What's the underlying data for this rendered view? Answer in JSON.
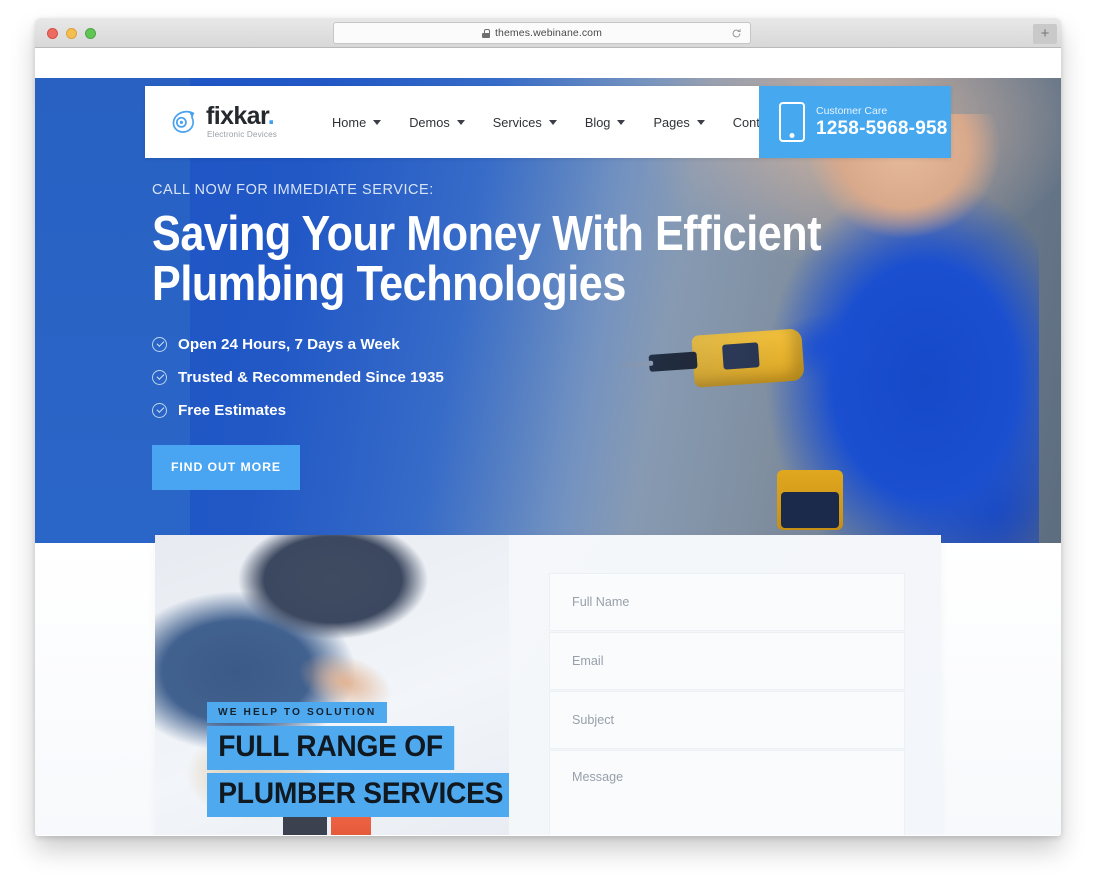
{
  "browser": {
    "url": "themes.webinane.com",
    "lock_icon": "lock-icon",
    "reload_icon": "reload-icon",
    "new_tab_label": "+",
    "traffic_lights": [
      "close",
      "minimize",
      "zoom"
    ]
  },
  "site": {
    "brand": {
      "name": "fixkar",
      "dot": ".",
      "tagline": "Electronic Devices",
      "mark_icon": "comet-logo-icon"
    },
    "nav": [
      {
        "label": "Home",
        "has_dropdown": true
      },
      {
        "label": "Demos",
        "has_dropdown": true
      },
      {
        "label": "Services",
        "has_dropdown": true
      },
      {
        "label": "Blog",
        "has_dropdown": true
      },
      {
        "label": "Pages",
        "has_dropdown": true
      },
      {
        "label": "Contact Us",
        "has_dropdown": false
      }
    ],
    "customer_care": {
      "label": "Customer Care",
      "number": "1258-5968-958",
      "icon": "mobile-phone-icon",
      "bg_color": "#46a8ef"
    },
    "hero": {
      "eyebrow": "CALL NOW FOR IMMEDIATE SERVICE:",
      "title": "Saving Your Money With Efficient\nPlumbing Technologies",
      "features": [
        "Open 24 Hours, 7 Days a Week",
        "Trusted & Recommended Since 1935",
        "Free Estimates"
      ],
      "cta_label": "FIND OUT MORE",
      "cta_color": "#49a5f2",
      "bg_color": "#1c53c4"
    },
    "promo": {
      "kicker": "WE HELP TO SOLUTION",
      "line1": "FULL RANGE OF",
      "line2": "PLUMBER SERVICES",
      "highlight_color": "#4fa9ee"
    },
    "contact_form": {
      "full_name_placeholder": "Full Name",
      "email_placeholder": "Email",
      "subject_placeholder": "Subject",
      "message_placeholder": "Message",
      "full_name_value": "",
      "email_value": "",
      "subject_value": "",
      "message_value": ""
    }
  }
}
